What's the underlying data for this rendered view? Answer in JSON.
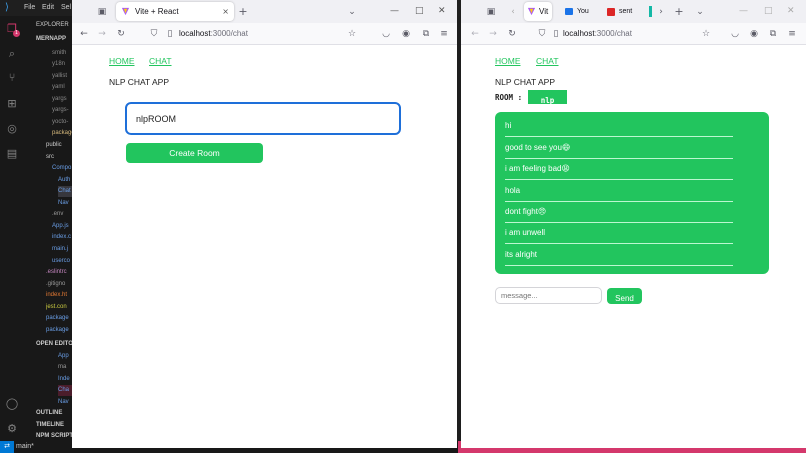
{
  "vscode": {
    "menu": [
      "File",
      "Edit",
      "Sel"
    ],
    "explorer_title": "EXPLORER",
    "project_root": "MERNAPP",
    "tree_items": [
      "smith",
      "y18n",
      "yallist",
      "yaml",
      "yargs",
      "yargs-",
      "yocto-",
      "package",
      "public",
      "src",
      "Compo",
      "Auth",
      "Chat",
      "Nav",
      ".env",
      "App.js",
      "index.c",
      "main.j",
      "userco",
      ".eslintrc",
      ".gitigno",
      "index.ht",
      "jest.con",
      "package",
      "package"
    ],
    "open_editors_title": "OPEN EDITORS",
    "open_editors": [
      "App",
      "ma",
      "Inde",
      "Cha",
      "Nav"
    ],
    "outline": "OUTLINE",
    "timeline": "TIMELINE",
    "npm_scripts": "NPM SCRIPTS",
    "branch": "main*",
    "notification_badge": "1"
  },
  "left_browser": {
    "tab_title": "Vite + React",
    "url_host": "localhost",
    "url_path": ":3000/chat",
    "nav": {
      "home": "HOME",
      "chat": "CHAT"
    },
    "app_title": "NLP CHAT APP",
    "room_input_value": "nlpROOM",
    "create_room_label": "Create Room"
  },
  "right_browser": {
    "tabs": [
      {
        "title": "Vit"
      },
      {
        "title": "You"
      },
      {
        "title": "sent"
      }
    ],
    "url_host": "localhost",
    "url_path": ":3000/chat",
    "nav": {
      "home": "HOME",
      "chat": "CHAT"
    },
    "app_title": "NLP CHAT APP",
    "room_label": "ROOM :",
    "room_name": "nlp",
    "messages": [
      {
        "text": "hi",
        "emoji": ""
      },
      {
        "text": "good to see you",
        "emoji": "😄"
      },
      {
        "text": "i am feeling bad",
        "emoji": "😫"
      },
      {
        "text": "hola",
        "emoji": ""
      },
      {
        "text": "dont fight",
        "emoji": "😠"
      },
      {
        "text": "i am unwell",
        "emoji": ""
      },
      {
        "text": "its alright",
        "emoji": ""
      }
    ],
    "message_placeholder": "message...",
    "send_label": "Send"
  },
  "colors": {
    "accent_green": "#22c55e",
    "focus_blue": "#1e6fd9",
    "vscode_blue": "#0078d4",
    "taskbar_pink": "#d4386c"
  }
}
